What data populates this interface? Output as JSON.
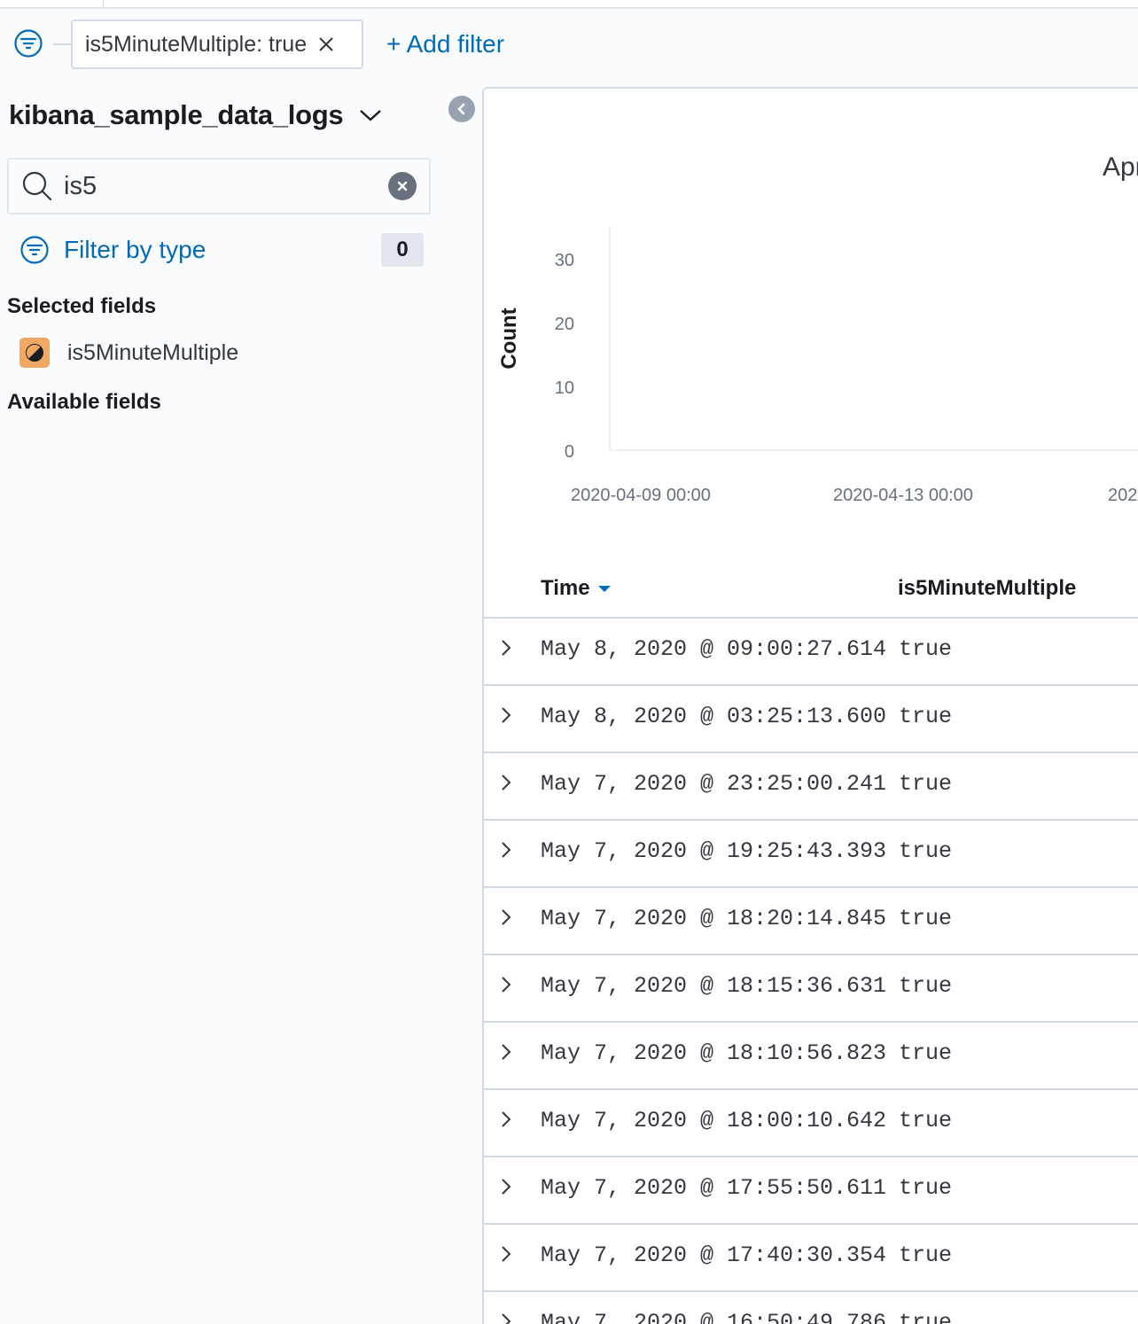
{
  "filter_bar": {
    "pill_label": "is5MinuteMultiple: true",
    "add_filter_label": "+ Add filter"
  },
  "sidebar": {
    "index_pattern": "kibana_sample_data_logs",
    "search_value": "is5",
    "filter_by_type_label": "Filter by type",
    "filter_count": "0",
    "selected_fields_title": "Selected fields",
    "selected_fields": [
      {
        "name": "is5MinuteMultiple",
        "type_icon": "boolean-token-icon"
      }
    ],
    "available_fields_title": "Available fields"
  },
  "chart_data": {
    "type": "bar",
    "title": "Apr",
    "xlabel": "",
    "ylabel": "Count",
    "y_ticks": [
      "0",
      "10",
      "20",
      "30"
    ],
    "ylim": [
      0,
      35
    ],
    "x_ticks": [
      "2020-04-09 00:00",
      "2020-04-13 00:00",
      "2020"
    ],
    "categories": [],
    "values": []
  },
  "table": {
    "columns": [
      "Time",
      "is5MinuteMultiple"
    ],
    "rows": [
      {
        "time": "May 8, 2020 @ 09:00:27.614",
        "value": "true"
      },
      {
        "time": "May 8, 2020 @ 03:25:13.600",
        "value": "true"
      },
      {
        "time": "May 7, 2020 @ 23:25:00.241",
        "value": "true"
      },
      {
        "time": "May 7, 2020 @ 19:25:43.393",
        "value": "true"
      },
      {
        "time": "May 7, 2020 @ 18:20:14.845",
        "value": "true"
      },
      {
        "time": "May 7, 2020 @ 18:15:36.631",
        "value": "true"
      },
      {
        "time": "May 7, 2020 @ 18:10:56.823",
        "value": "true"
      },
      {
        "time": "May 7, 2020 @ 18:00:10.642",
        "value": "true"
      },
      {
        "time": "May 7, 2020 @ 17:55:50.611",
        "value": "true"
      },
      {
        "time": "May 7, 2020 @ 17:40:30.354",
        "value": "true"
      },
      {
        "time": "May 7, 2020 @ 16:50:49.786",
        "value": "true"
      }
    ]
  }
}
